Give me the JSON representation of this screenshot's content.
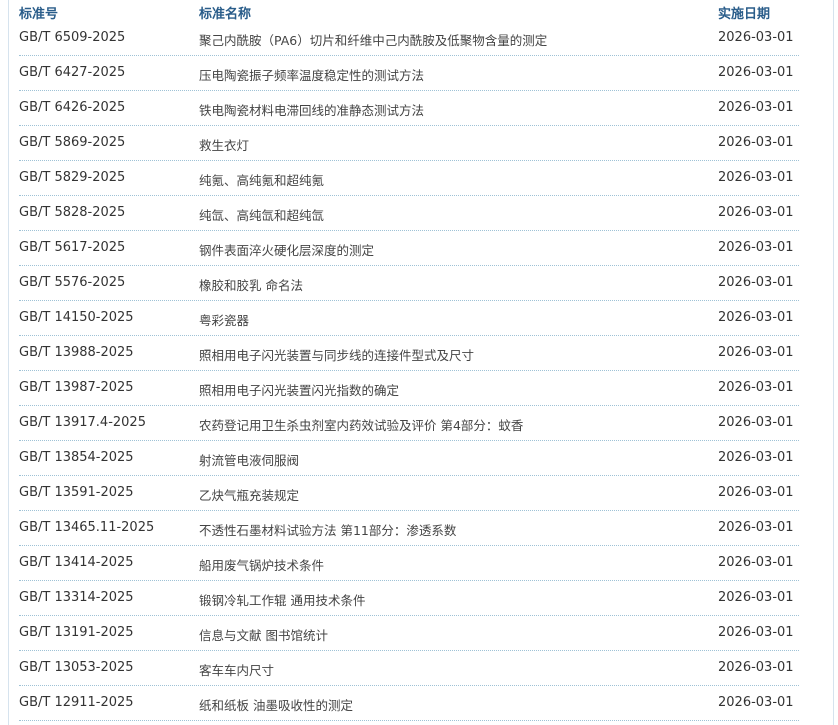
{
  "header": {
    "code": "标准号",
    "name": "标准名称",
    "date": "实施日期"
  },
  "rows": [
    {
      "code": "GB/T 6509-2025",
      "name": "聚己内酰胺（PA6）切片和纤维中己内酰胺及低聚物含量的测定",
      "date": "2026-03-01"
    },
    {
      "code": "GB/T 6427-2025",
      "name": "压电陶瓷振子频率温度稳定性的测试方法",
      "date": "2026-03-01"
    },
    {
      "code": "GB/T 6426-2025",
      "name": "铁电陶瓷材料电滞回线的准静态测试方法",
      "date": "2026-03-01"
    },
    {
      "code": "GB/T 5869-2025",
      "name": "救生衣灯",
      "date": "2026-03-01"
    },
    {
      "code": "GB/T 5829-2025",
      "name": "纯氪、高纯氪和超纯氪",
      "date": "2026-03-01"
    },
    {
      "code": "GB/T 5828-2025",
      "name": "纯氙、高纯氙和超纯氙",
      "date": "2026-03-01"
    },
    {
      "code": "GB/T 5617-2025",
      "name": "钢件表面淬火硬化层深度的测定",
      "date": "2026-03-01"
    },
    {
      "code": "GB/T 5576-2025",
      "name": "橡胶和胶乳 命名法",
      "date": "2026-03-01"
    },
    {
      "code": "GB/T 14150-2025",
      "name": "粤彩瓷器",
      "date": "2026-03-01"
    },
    {
      "code": "GB/T 13988-2025",
      "name": "照相用电子闪光装置与同步线的连接件型式及尺寸",
      "date": "2026-03-01"
    },
    {
      "code": "GB/T 13987-2025",
      "name": "照相用电子闪光装置闪光指数的确定",
      "date": "2026-03-01"
    },
    {
      "code": "GB/T 13917.4-2025",
      "name": "农药登记用卫生杀虫剂室内药效试验及评价 第4部分：蚊香",
      "date": "2026-03-01"
    },
    {
      "code": "GB/T 13854-2025",
      "name": "射流管电液伺服阀",
      "date": "2026-03-01"
    },
    {
      "code": "GB/T 13591-2025",
      "name": "乙炔气瓶充装规定",
      "date": "2026-03-01"
    },
    {
      "code": "GB/T 13465.11-2025",
      "name": "不透性石墨材料试验方法 第11部分：渗透系数",
      "date": "2026-03-01"
    },
    {
      "code": "GB/T 13414-2025",
      "name": "船用废气锅炉技术条件",
      "date": "2026-03-01"
    },
    {
      "code": "GB/T 13314-2025",
      "name": "锻钢冷轧工作辊 通用技术条件",
      "date": "2026-03-01"
    },
    {
      "code": "GB/T 13191-2025",
      "name": "信息与文献 图书馆统计",
      "date": "2026-03-01"
    },
    {
      "code": "GB/T 13053-2025",
      "name": "客车车内尺寸",
      "date": "2026-03-01"
    },
    {
      "code": "GB/T 12911-2025",
      "name": "纸和纸板 油墨吸收性的测定",
      "date": "2026-03-01"
    }
  ]
}
